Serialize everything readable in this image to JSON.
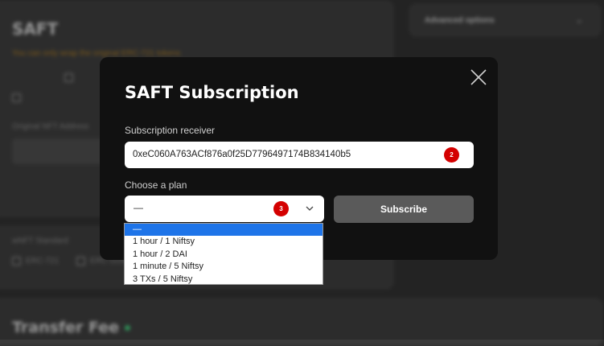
{
  "background": {
    "saft_title": "SAFT",
    "warning": "You can only wrap the original ERC-721 tokens",
    "advanced_options": "Advanced options",
    "original_nft_address_label": "Original NFT Address",
    "wnft_standard_label": "wNFT Standard",
    "erc721": "ERC-721",
    "erc1155": "ERC-1155",
    "transfer_fee_title": "Transfer Fee"
  },
  "modal": {
    "title": "SAFT Subscription",
    "receiver_label": "Subscription receiver",
    "receiver_value": "0xeC060A763ACf876a0f25D7796497174B834140b5",
    "receiver_badge": "2",
    "plan_label": "Choose a plan",
    "plan_selected": "—",
    "plan_badge": "3",
    "subscribe_label": "Subscribe"
  },
  "dropdown": {
    "options": [
      "—",
      "1 hour / 1 Niftsy",
      "1 hour / 2 DAI",
      "1 minute / 5 Niftsy",
      "3 TXs / 5 Niftsy"
    ],
    "selected_index": 0
  },
  "colors": {
    "modal_bg": "#111111",
    "badge": "#d40000",
    "highlight": "#1e74e8",
    "button_disabled": "#5a5a5a"
  }
}
